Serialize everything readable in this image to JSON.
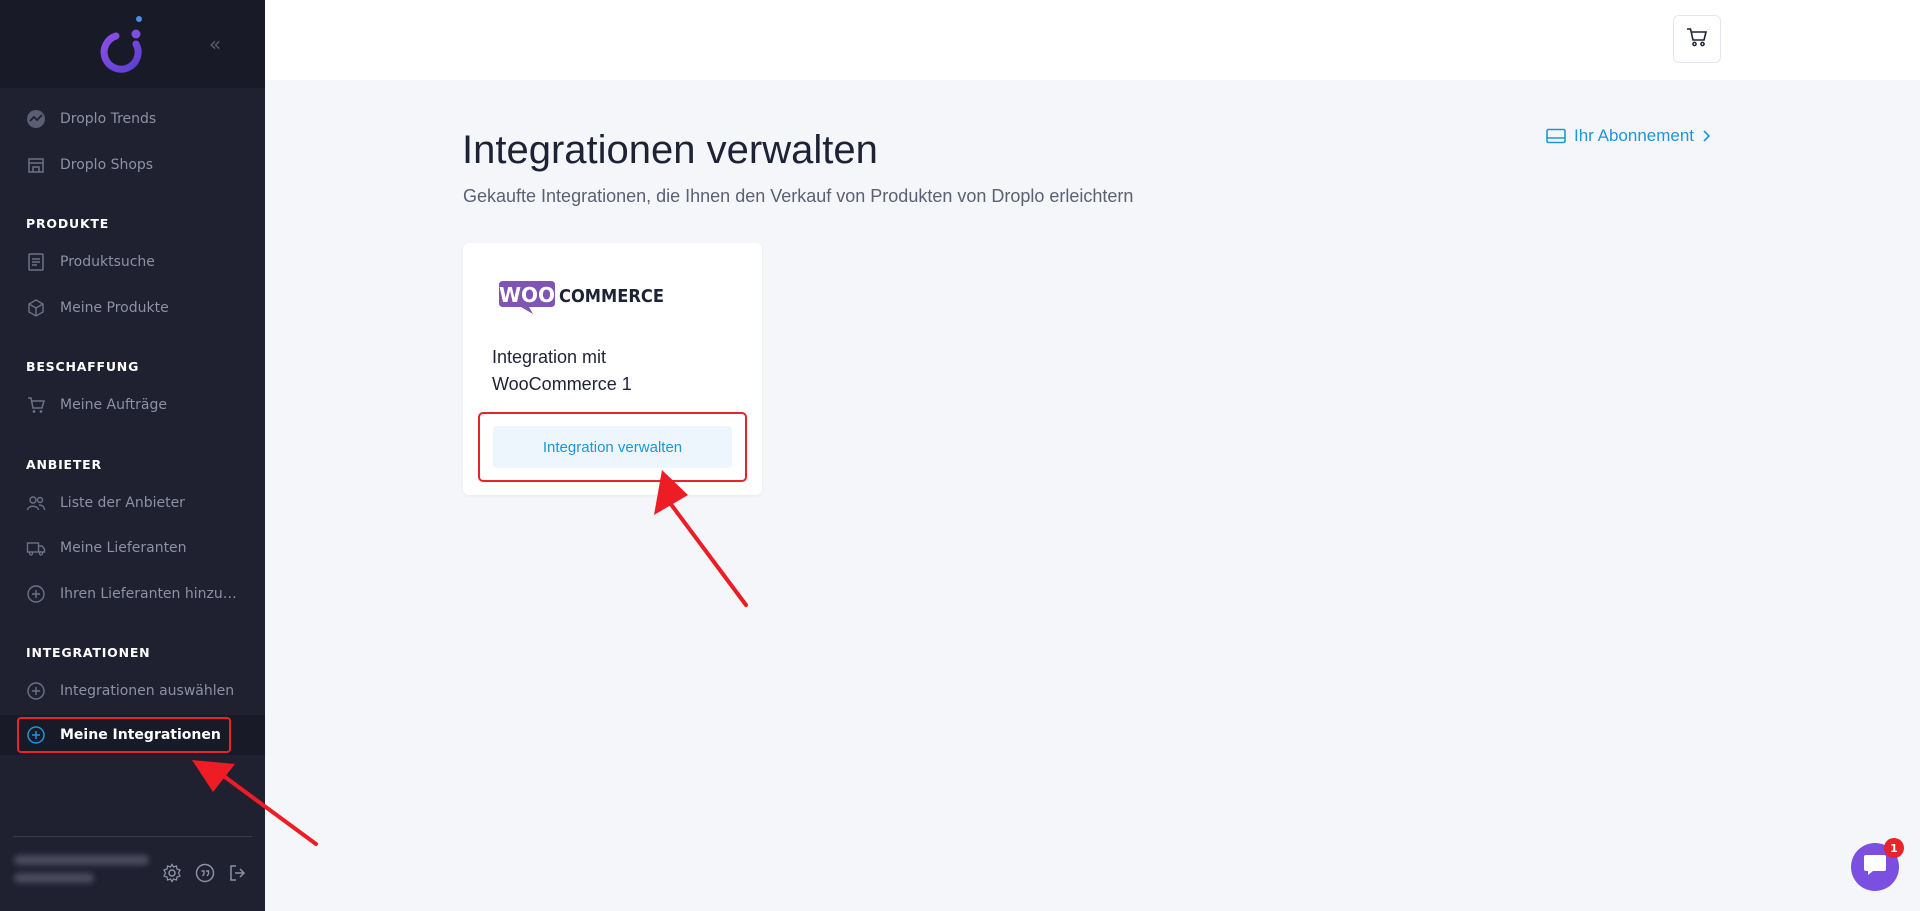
{
  "sidebar": {
    "top_items": [
      {
        "label": "Droplo Trends",
        "icon": "trends-icon"
      },
      {
        "label": "Droplo Shops",
        "icon": "shop-icon"
      }
    ],
    "sections": [
      {
        "title": "PRODUKTE",
        "items": [
          {
            "label": "Produktsuche",
            "icon": "list-search-icon"
          },
          {
            "label": "Meine Produkte",
            "icon": "box-icon"
          }
        ]
      },
      {
        "title": "BESCHAFFUNG",
        "items": [
          {
            "label": "Meine Aufträge",
            "icon": "cart-icon"
          }
        ]
      },
      {
        "title": "ANBIETER",
        "items": [
          {
            "label": "Liste der Anbieter",
            "icon": "users-icon"
          },
          {
            "label": "Meine Lieferanten",
            "icon": "truck-icon"
          },
          {
            "label": "Ihren Lieferanten hinzufügen",
            "icon": "plus-circle-icon"
          }
        ]
      },
      {
        "title": "INTEGRATIONEN",
        "items": [
          {
            "label": "Integrationen auswählen",
            "icon": "plus-circle-icon"
          },
          {
            "label": "Meine Integrationen",
            "icon": "plus-circle-icon",
            "active": true
          }
        ]
      }
    ]
  },
  "main": {
    "title": "Integrationen verwalten",
    "subtitle": "Gekaufte Integrationen, die Ihnen den Verkauf von Produkten von Droplo erleichtern",
    "subscription_link": "Ihr Abonnement",
    "cards": [
      {
        "logo_text": "WOO COMMERCE",
        "title": "Integration mit WooCommerce 1",
        "button": "Integration verwalten"
      }
    ]
  },
  "chat": {
    "badge": "1"
  },
  "colors": {
    "sidebar_bg": "#1f2030",
    "accent": "#1e96db",
    "woo_purple": "#7f54b3",
    "highlight": "#e8232a",
    "chat": "#7b4fe0"
  }
}
